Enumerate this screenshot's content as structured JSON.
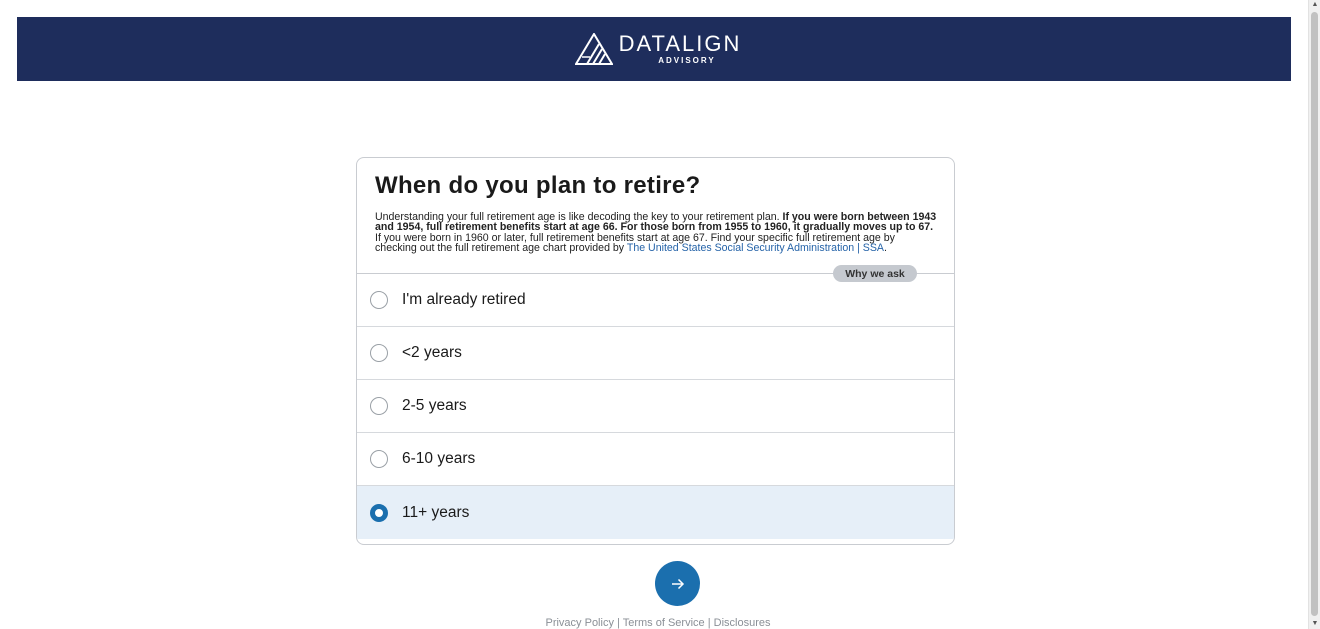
{
  "header": {
    "brand_name": "DATALIGN",
    "brand_sub": "ADVISORY",
    "background_color": "#1e2d5c"
  },
  "question": {
    "title": "When do you plan to retire?",
    "description": {
      "p1": "Understanding your full retirement age is like decoding the key to your retirement plan.",
      "b1": "If you were born between 1943 and 1954, full retirement benefits start at age 66. For those born from 1955 to 1960, it gradually moves up to 67.",
      "p2": "If you were born in 1960 or later, full retirement benefits start at age 67. Find your specific full retirement age by checking out the full retirement age chart provided by",
      "link_text": "The United States Social Security Administration | SSA",
      "end": "."
    },
    "why_label": "Why we ask"
  },
  "options": [
    {
      "label": "I'm already retired",
      "selected": false
    },
    {
      "label": "<2 years",
      "selected": false
    },
    {
      "label": "2-5 years",
      "selected": false
    },
    {
      "label": "6-10 years",
      "selected": false
    },
    {
      "label": "11+ years",
      "selected": true
    }
  ],
  "next_button": {
    "icon": "arrow-right-icon",
    "color": "#1b6fae"
  },
  "footer": {
    "privacy": "Privacy Policy",
    "terms": "Terms of Service",
    "disclosures": "Disclosures",
    "separator": "|"
  }
}
